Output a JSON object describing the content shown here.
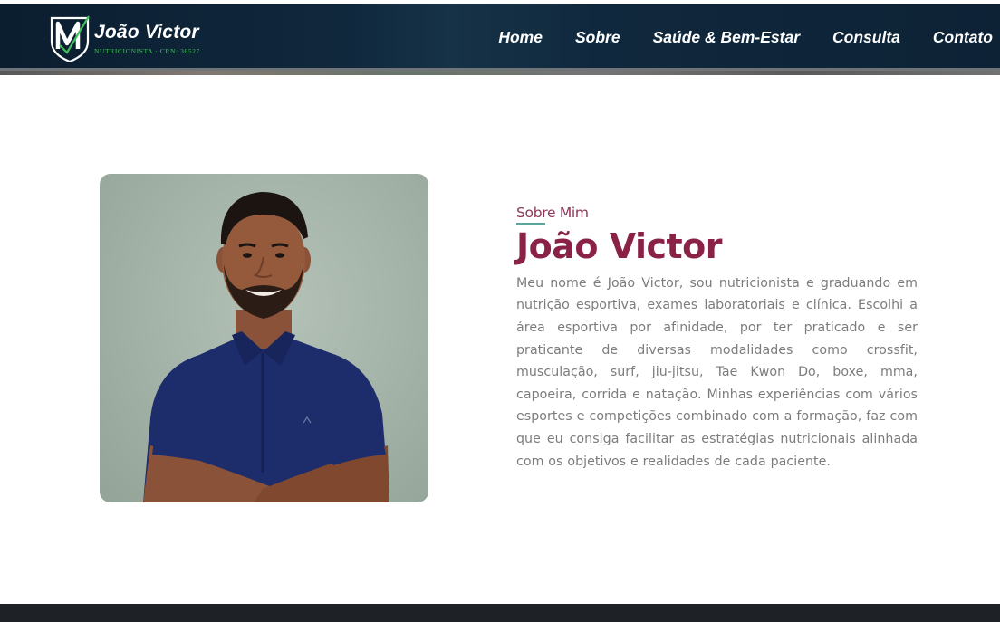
{
  "header": {
    "logo_name": "João Victor",
    "logo_subtitle": "NUTRICIONISTA · CRN: 36527",
    "nav": [
      {
        "label": "Home"
      },
      {
        "label": "Sobre"
      },
      {
        "label": "Saúde & Bem-Estar"
      },
      {
        "label": "Consulta"
      },
      {
        "label": "Contato"
      }
    ]
  },
  "about": {
    "kicker": "Sobre Mim",
    "title": "João Victor",
    "bio": "Meu nome é João Victor, sou nutricionista e graduando em nutrição esportiva, exames laboratoriais e clínica. Escolhi a área esportiva por afinidade, por ter praticado e ser praticante de diversas modalidades como crossfit, musculação, surf, jiu-jitsu, Tae Kwon Do, boxe, mma, capoeira, corrida e natação. Minhas experiências com vários esportes e competições combinado com a formação, faz com que eu consiga facilitar as estratégias nutricionais alinhada com os objetivos e realidades de cada paciente."
  },
  "colors": {
    "header_bg": "#0d2235",
    "accent": "#8a2247",
    "logo_green": "#3fbf5a",
    "text_gray": "#7c7c7c",
    "footer_bg": "#1e2227"
  }
}
